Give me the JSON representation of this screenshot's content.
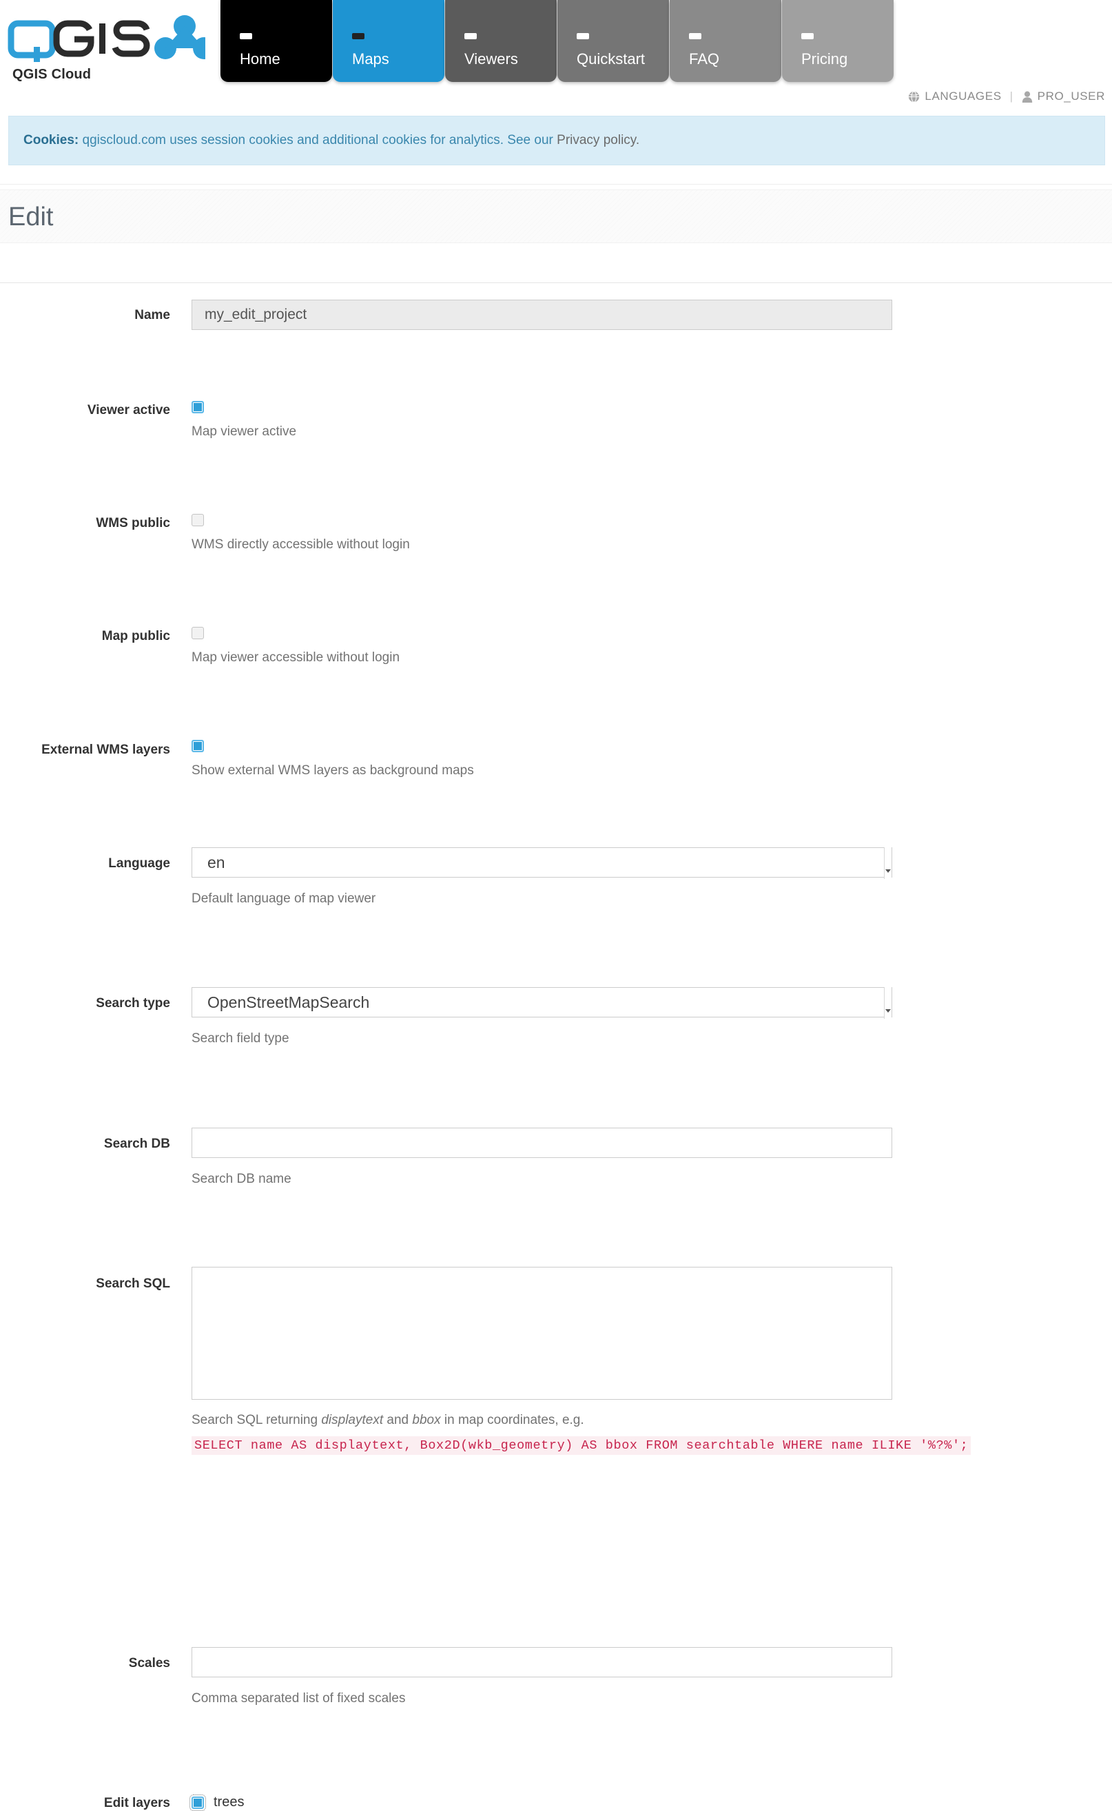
{
  "brand": {
    "name": "QGIS",
    "subtitle": "QGIS Cloud",
    "logo_icon": "qgis-cloud-logo"
  },
  "nav": {
    "tabs": [
      {
        "label": "Home",
        "state": "default",
        "color": "#000000"
      },
      {
        "label": "Maps",
        "state": "active",
        "color": "#1e94d2"
      },
      {
        "label": "Viewers",
        "state": "default",
        "color": "#5b5b5b"
      },
      {
        "label": "Quickstart",
        "state": "default",
        "color": "#757575"
      },
      {
        "label": "FAQ",
        "state": "default",
        "color": "#8a8a8a"
      },
      {
        "label": "Pricing",
        "state": "default",
        "color": "#a0a0a0"
      }
    ]
  },
  "userbar": {
    "languages_label": "LANGUAGES",
    "languages_icon": "globe-icon",
    "separator": "|",
    "user_label": "PRO_USER",
    "user_icon": "person-icon"
  },
  "cookie_banner": {
    "strong": "Cookies:",
    "text": " qgiscloud.com uses session cookies and additional cookies for analytics. See our ",
    "link": "Privacy policy.",
    "background": "#d9edf7",
    "text_color": "#3a87ad"
  },
  "page": {
    "title": "Edit"
  },
  "form": {
    "name": {
      "label": "Name",
      "value": "my_edit_project"
    },
    "viewer_active": {
      "label": "Viewer active",
      "checked": true,
      "hint": "Map viewer active"
    },
    "wms_public": {
      "label": "WMS public",
      "checked": false,
      "hint": "WMS directly accessible without login"
    },
    "map_public": {
      "label": "Map public",
      "checked": false,
      "hint": "Map viewer accessible without login"
    },
    "external_wms_layers": {
      "label": "External WMS layers",
      "checked": true,
      "hint": "Show external WMS layers as background maps"
    },
    "language": {
      "label": "Language",
      "value": "en",
      "hint": "Default language of map viewer"
    },
    "search_type": {
      "label": "Search type",
      "value": "OpenStreetMapSearch",
      "hint": "Search field type"
    },
    "search_db": {
      "label": "Search DB",
      "value": "",
      "hint": "Search DB name"
    },
    "search_sql": {
      "label": "Search SQL",
      "value": "",
      "hint_prefix": "Search SQL returning ",
      "hint_em1": "displaytext",
      "hint_mid": " and ",
      "hint_em2": "bbox",
      "hint_suffix": " in map coordinates, e.g.",
      "code_example": "SELECT name AS displaytext, Box2D(wkb_geometry) AS bbox FROM searchtable WHERE name ILIKE '%?%';"
    },
    "scales": {
      "label": "Scales",
      "value": "",
      "hint": "Comma separated list of fixed scales"
    },
    "edit_layers": {
      "label": "Edit layers",
      "layers": [
        {
          "name": "trees",
          "checked": true
        }
      ]
    }
  }
}
